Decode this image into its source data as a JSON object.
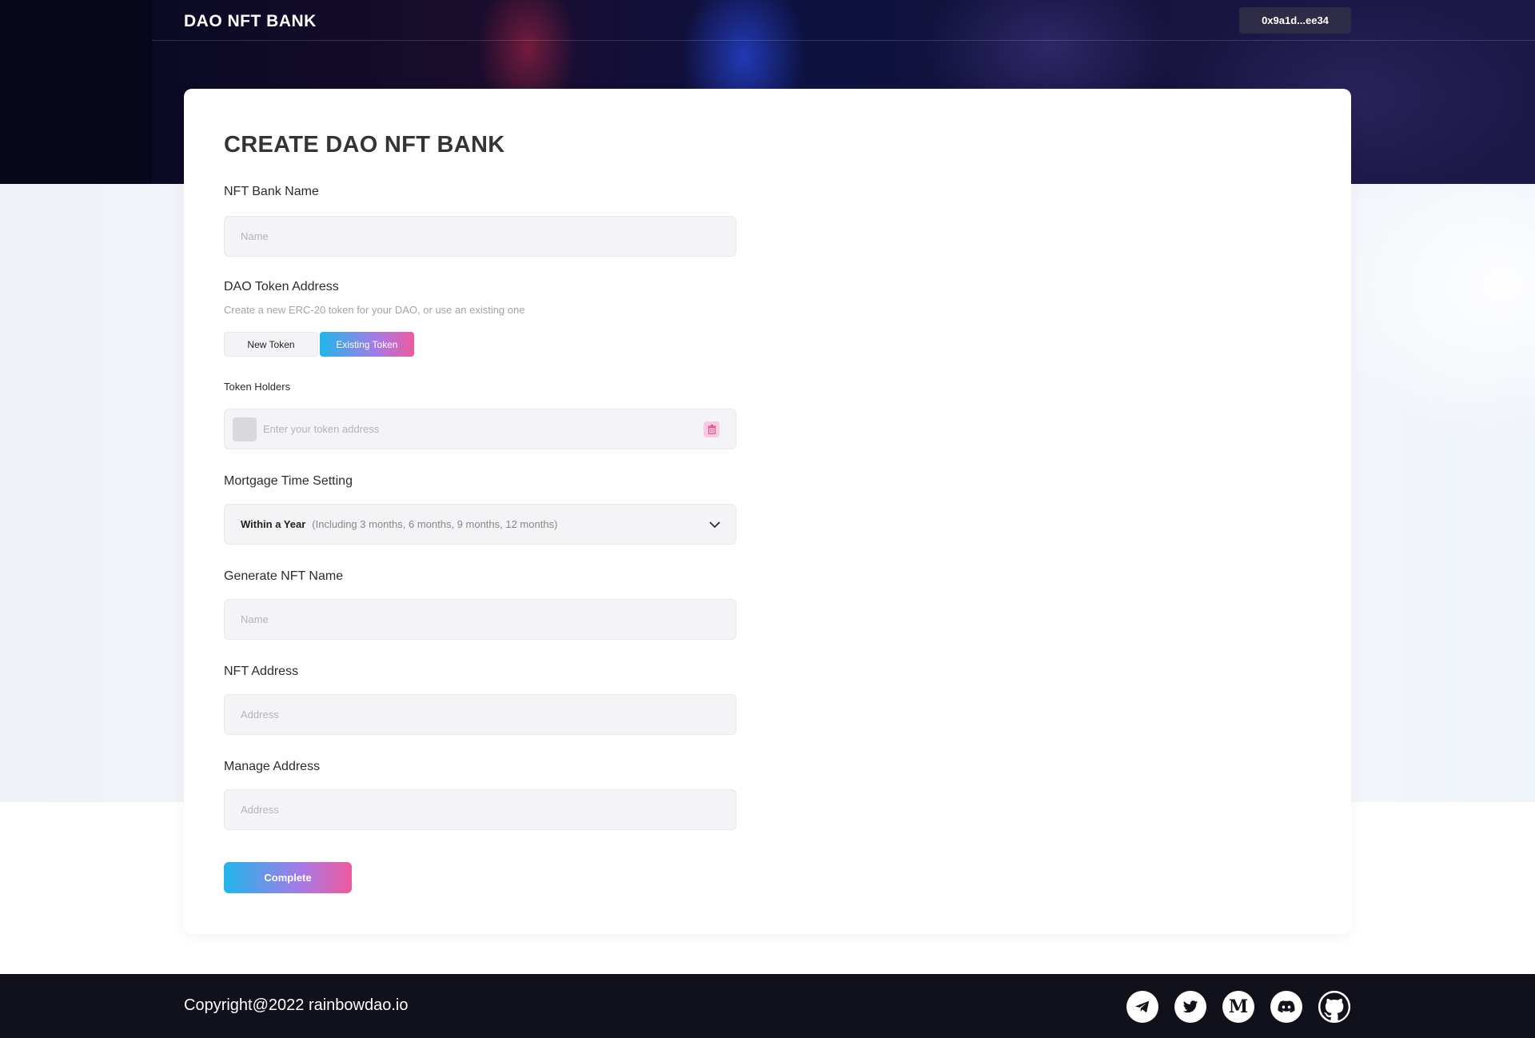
{
  "header": {
    "brand": "DAO NFT BANK",
    "wallet_address": "0x9a1d...ee34"
  },
  "form": {
    "title": "CREATE DAO NFT BANK",
    "bank_name": {
      "label": "NFT Bank Name",
      "placeholder": "Name",
      "value": ""
    },
    "token_address": {
      "label": "DAO Token Address",
      "hint": "Create a new ERC-20 token for your DAO, or use an existing one",
      "options": [
        "New Token",
        "Existing Token"
      ],
      "selected": "Existing Token"
    },
    "token_holders": {
      "label": "Token Holders",
      "placeholder": "Enter your token address",
      "value": ""
    },
    "mortgage": {
      "label": "Mortgage Time Setting",
      "selected_value": "Within a Year",
      "selected_detail": "(Including 3 months, 6 months, 9 months, 12 months)"
    },
    "nft_name": {
      "label": "Generate NFT Name",
      "placeholder": "Name",
      "value": ""
    },
    "nft_address": {
      "label": "NFT Address",
      "placeholder": "Address",
      "value": ""
    },
    "manage_address": {
      "label": "Manage Address",
      "placeholder": "Address",
      "value": ""
    },
    "submit_label": "Complete"
  },
  "footer": {
    "copyright": "Copyright@2022 rainbowdao.io",
    "socials": [
      "telegram-icon",
      "twitter-icon",
      "medium-icon",
      "discord-icon",
      "github-icon"
    ],
    "medium_letter": "M"
  },
  "colors": {
    "accent_gradient_start": "#1fb6ea",
    "accent_gradient_end": "#ee5a9e",
    "footer_bg": "#11111b",
    "hero_bg": "#07061a"
  }
}
